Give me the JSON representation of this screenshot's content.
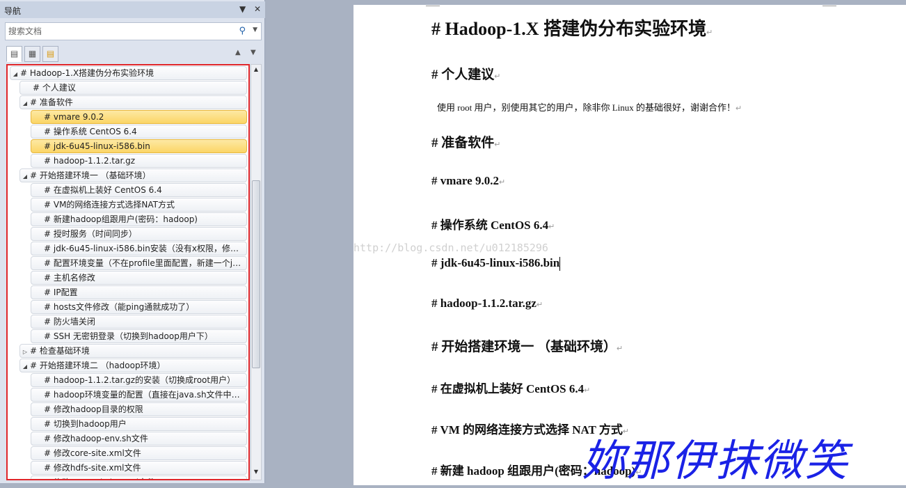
{
  "nav": {
    "title": "导航",
    "search_placeholder": "搜索文档",
    "tree": [
      {
        "label": "# Hadoop-1.X搭建伪分布实验环境",
        "level": 0,
        "twisty": "expanded"
      },
      {
        "label": "# 个人建议",
        "level": 1
      },
      {
        "label": "# 准备软件",
        "level": 1,
        "twisty": "expanded"
      },
      {
        "label": "# vmare 9.0.2",
        "level": 2,
        "state": "highlight"
      },
      {
        "label": "# 操作系统 CentOS 6.4",
        "level": 2
      },
      {
        "label": "# jdk-6u45-linux-i586.bin",
        "level": 2,
        "state": "highlight"
      },
      {
        "label": "# hadoop-1.1.2.tar.gz",
        "level": 2
      },
      {
        "label": "# 开始搭建环境一 （基础环境）",
        "level": 1,
        "twisty": "expanded"
      },
      {
        "label": "# 在虚拟机上装好 CentOS 6.4",
        "level": 2
      },
      {
        "label": "# VM的网络连接方式选择NAT方式",
        "level": 2
      },
      {
        "label": "# 新建hadoop组跟用户(密码：hadoop)",
        "level": 2
      },
      {
        "label": "# 授时服务（时间同步）",
        "level": 2
      },
      {
        "label": "# jdk-6u45-linux-i586.bin安装（没有x权限，修改...",
        "level": 2
      },
      {
        "label": "# 配置环境变量（不在profile里面配置，新建一个ja...",
        "level": 2
      },
      {
        "label": "# 主机名修改",
        "level": 2
      },
      {
        "label": "# IP配置",
        "level": 2
      },
      {
        "label": "# hosts文件修改（能ping通就成功了）",
        "level": 2
      },
      {
        "label": "# 防火墙关闭",
        "level": 2
      },
      {
        "label": "# SSH 无密钥登录（切换到hadoop用户下）",
        "level": 2
      },
      {
        "label": "# 检查基础环境",
        "level": 1,
        "twisty": "collapsed"
      },
      {
        "label": "# 开始搭建环境二 （hadoop环境）",
        "level": 1,
        "twisty": "expanded"
      },
      {
        "label": "# hadoop-1.1.2.tar.gz的安装（切换成root用户）",
        "level": 2
      },
      {
        "label": "# hadoop环境变量的配置（直接在java.sh文件中配...",
        "level": 2
      },
      {
        "label": "# 修改hadoop目录的权限",
        "level": 2
      },
      {
        "label": "# 切换到hadoop用户",
        "level": 2
      },
      {
        "label": "# 修改hadoop-env.sh文件",
        "level": 2
      },
      {
        "label": "# 修改core-site.xml文件",
        "level": 2
      },
      {
        "label": "# 修改hdfs-site.xml文件",
        "level": 2
      },
      {
        "label": "# 修改mapred-site.xml文件",
        "level": 2
      }
    ]
  },
  "doc": {
    "title": "# Hadoop-1.X 搭建伪分布实验环境",
    "h_personal": "# 个人建议",
    "p_personal": "使用 root 用户，别使用其它的用户，除非你 Linux 的基础很好，谢谢合作！",
    "h_software": "# 准备软件",
    "h_vmare": "# vmare 9.0.2",
    "h_os": "# 操作系统 CentOS 6.4",
    "h_jdk": "# jdk-6u45-linux-i586.bin",
    "h_hadoop": "# hadoop-1.1.2.tar.gz",
    "h_env1": "# 开始搭建环境一 （基础环境）",
    "h_vm": "# 在虚拟机上装好 CentOS 6.4",
    "h_nat": "# VM 的网络连接方式选择 NAT 方式",
    "h_user": "# 新建 hadoop 组跟用户(密码：hadoop)",
    "watermark": "http://blog.csdn.net/u012185296",
    "signature": "妳那伊抹微笑"
  }
}
